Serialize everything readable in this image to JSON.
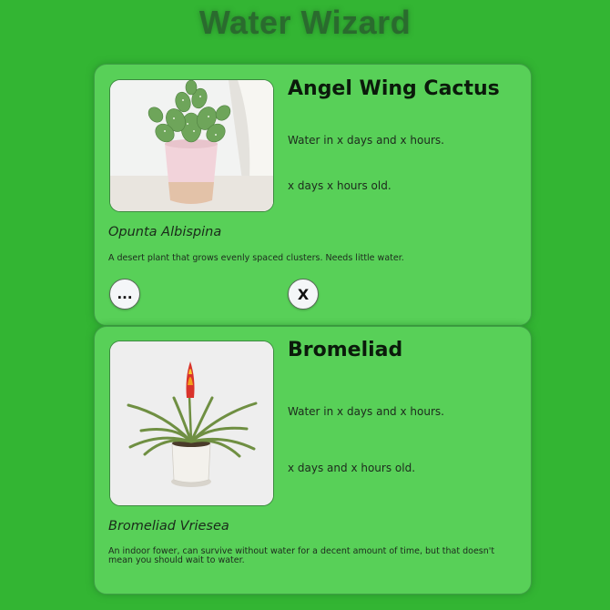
{
  "app": {
    "title": "Water Wizard"
  },
  "plants": [
    {
      "name": "Angel Wing Cactus",
      "water_text": "Water in x days and x hours.",
      "age_text": "x days x hours old.",
      "scientific_name": "Opunta Albispina",
      "description": "A desert plant that grows evenly spaced clusters. Needs little water.",
      "more_label": "...",
      "delete_label": "X",
      "image_icon": "potted-cactus-image"
    },
    {
      "name": "Bromeliad",
      "water_text": "Water in x days and x hours.",
      "age_text": "x days and x hours old.",
      "scientific_name": "Bromeliad Vriesea",
      "description": "An indoor fower, can survive without water for a decent amount of time, but that doesn't mean you should wait to water.",
      "image_icon": "potted-bromeliad-image"
    }
  ],
  "colors": {
    "background": "#33b533",
    "card": "#58d058",
    "title": "#2a6b2e"
  }
}
